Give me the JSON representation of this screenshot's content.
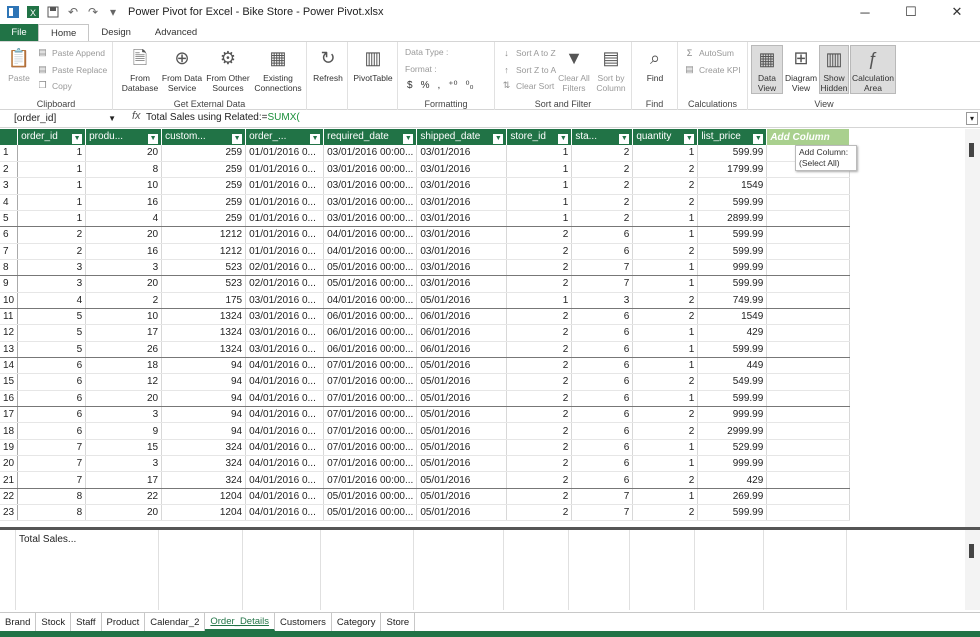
{
  "window": {
    "title": "Power Pivot for Excel - Bike Store - Power Pivot.xlsx"
  },
  "tabs": [
    "File",
    "Home",
    "Design",
    "Advanced"
  ],
  "ribbon": {
    "clipboard": {
      "label": "Clipboard",
      "paste": "Paste",
      "paste_append": "Paste Append",
      "paste_replace": "Paste Replace",
      "copy": "Copy"
    },
    "external": {
      "label": "Get External Data",
      "from_database": "From Database",
      "from_data_service": "From Data Service",
      "from_other_sources": "From Other Sources",
      "existing_connections": "Existing Connections"
    },
    "refresh": {
      "label": "Refresh"
    },
    "pivottable": {
      "label": "PivotTable"
    },
    "formatting": {
      "label": "Formatting",
      "data_type": "Data Type :",
      "format": "Format :",
      "currency": "$",
      "percent": "%"
    },
    "sort": {
      "label": "Sort and Filter",
      "sort_az": "Sort A to Z",
      "sort_za": "Sort Z to A",
      "clear_sort": "Clear Sort",
      "clear_all_filters": "Clear All Filters",
      "sort_by_column": "Sort by Column"
    },
    "find": {
      "label": "Find",
      "find": "Find"
    },
    "calculations": {
      "label": "Calculations",
      "autosum": "AutoSum",
      "create_kpi": "Create KPI"
    },
    "view": {
      "label": "View",
      "data_view": "Data View",
      "diagram_view": "Diagram View",
      "show_hidden": "Show Hidden",
      "calculation_area": "Calculation Area"
    }
  },
  "formula_bar": {
    "name_box": "[order_id]",
    "formula_prefix": "Total Sales using Related:=",
    "formula_fn": "SUMX("
  },
  "columns": [
    "order_id",
    "produ...",
    "custom...",
    "order_...",
    "required_date",
    "shipped_date",
    "store_id",
    "sta...",
    "quantity",
    "list_price",
    "Add Column"
  ],
  "rows": [
    [
      "1",
      "20",
      "259",
      "01/01/2016 0...",
      "03/01/2016 00:00...",
      "03/01/2016",
      "1",
      "2",
      "1",
      "599.99"
    ],
    [
      "1",
      "8",
      "259",
      "01/01/2016 0...",
      "03/01/2016 00:00...",
      "03/01/2016",
      "1",
      "2",
      "2",
      "1799.99"
    ],
    [
      "1",
      "10",
      "259",
      "01/01/2016 0...",
      "03/01/2016 00:00...",
      "03/01/2016",
      "1",
      "2",
      "2",
      "1549"
    ],
    [
      "1",
      "16",
      "259",
      "01/01/2016 0...",
      "03/01/2016 00:00...",
      "03/01/2016",
      "1",
      "2",
      "2",
      "599.99"
    ],
    [
      "1",
      "4",
      "259",
      "01/01/2016 0...",
      "03/01/2016 00:00...",
      "03/01/2016",
      "1",
      "2",
      "1",
      "2899.99"
    ],
    [
      "2",
      "20",
      "1212",
      "01/01/2016 0...",
      "04/01/2016 00:00...",
      "03/01/2016",
      "2",
      "6",
      "1",
      "599.99"
    ],
    [
      "2",
      "16",
      "1212",
      "01/01/2016 0...",
      "04/01/2016 00:00...",
      "03/01/2016",
      "2",
      "6",
      "2",
      "599.99"
    ],
    [
      "3",
      "3",
      "523",
      "02/01/2016 0...",
      "05/01/2016 00:00...",
      "03/01/2016",
      "2",
      "7",
      "1",
      "999.99"
    ],
    [
      "3",
      "20",
      "523",
      "02/01/2016 0...",
      "05/01/2016 00:00...",
      "03/01/2016",
      "2",
      "7",
      "1",
      "599.99"
    ],
    [
      "4",
      "2",
      "175",
      "03/01/2016 0...",
      "04/01/2016 00:00...",
      "05/01/2016",
      "1",
      "3",
      "2",
      "749.99"
    ],
    [
      "5",
      "10",
      "1324",
      "03/01/2016 0...",
      "06/01/2016 00:00...",
      "06/01/2016",
      "2",
      "6",
      "2",
      "1549"
    ],
    [
      "5",
      "17",
      "1324",
      "03/01/2016 0...",
      "06/01/2016 00:00...",
      "06/01/2016",
      "2",
      "6",
      "1",
      "429"
    ],
    [
      "5",
      "26",
      "1324",
      "03/01/2016 0...",
      "06/01/2016 00:00...",
      "06/01/2016",
      "2",
      "6",
      "1",
      "599.99"
    ],
    [
      "6",
      "18",
      "94",
      "04/01/2016 0...",
      "07/01/2016 00:00...",
      "05/01/2016",
      "2",
      "6",
      "1",
      "449"
    ],
    [
      "6",
      "12",
      "94",
      "04/01/2016 0...",
      "07/01/2016 00:00...",
      "05/01/2016",
      "2",
      "6",
      "2",
      "549.99"
    ],
    [
      "6",
      "20",
      "94",
      "04/01/2016 0...",
      "07/01/2016 00:00...",
      "05/01/2016",
      "2",
      "6",
      "1",
      "599.99"
    ],
    [
      "6",
      "3",
      "94",
      "04/01/2016 0...",
      "07/01/2016 00:00...",
      "05/01/2016",
      "2",
      "6",
      "2",
      "999.99"
    ],
    [
      "6",
      "9",
      "94",
      "04/01/2016 0...",
      "07/01/2016 00:00...",
      "05/01/2016",
      "2",
      "6",
      "2",
      "2999.99"
    ],
    [
      "7",
      "15",
      "324",
      "04/01/2016 0...",
      "07/01/2016 00:00...",
      "05/01/2016",
      "2",
      "6",
      "1",
      "529.99"
    ],
    [
      "7",
      "3",
      "324",
      "04/01/2016 0...",
      "07/01/2016 00:00...",
      "05/01/2016",
      "2",
      "6",
      "1",
      "999.99"
    ],
    [
      "7",
      "17",
      "324",
      "04/01/2016 0...",
      "07/01/2016 00:00...",
      "05/01/2016",
      "2",
      "6",
      "2",
      "429"
    ],
    [
      "8",
      "22",
      "1204",
      "04/01/2016 0...",
      "05/01/2016 00:00...",
      "05/01/2016",
      "2",
      "7",
      "1",
      "269.99"
    ],
    [
      "8",
      "20",
      "1204",
      "04/01/2016 0...",
      "05/01/2016 00:00...",
      "05/01/2016",
      "2",
      "7",
      "2",
      "599.99"
    ]
  ],
  "tooltip": {
    "line1": "Add Column:",
    "line2": "(Select All)"
  },
  "calc_area": {
    "measure": "Total Sales..."
  },
  "sheets": [
    "Brand",
    "Stock",
    "Staff",
    "Product",
    "Calendar_2",
    "Order_Details",
    "Customers",
    "Category",
    "Store"
  ],
  "active_sheet": "Order_Details",
  "colors": {
    "accent": "#217346",
    "add_column": "#a9d08e"
  }
}
